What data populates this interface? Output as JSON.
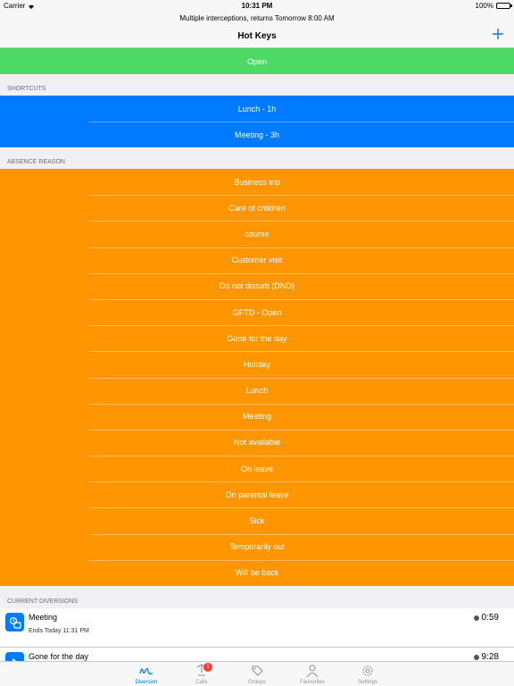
{
  "status_bar": {
    "carrier": "Carrier",
    "time": "10:31 PM",
    "battery": "100%"
  },
  "nav": {
    "subtitle": "Multiple interceptions, returns Tomorrow 8:00 AM",
    "title": "Hot Keys",
    "add_icon": "plus-icon"
  },
  "open_button": {
    "label": "Open",
    "color": "#4cd964"
  },
  "shortcuts": {
    "header": "SHORTCUTS",
    "color": "#007aff",
    "items": [
      "Lunch - 1h",
      "Meeting - 3h"
    ]
  },
  "absence": {
    "header": "ABSENCE REASON",
    "color": "#ff9500",
    "items": [
      "Business trip",
      "Care of children",
      "course",
      "Customer visit",
      "Do not disturb (DND)",
      "GFTD - Open",
      "Gone for the day",
      "Holiday",
      "Lunch",
      "Meeting",
      "Not available",
      "On leave",
      "On parental leave",
      "Sick",
      "Temporarily out",
      "Will be back"
    ]
  },
  "current_diversions": {
    "header": "CURRENT DIVERSIONS",
    "items": [
      {
        "name": "Meeting",
        "ends": "Ends Today 11:31 PM",
        "timer": "0:59"
      },
      {
        "name": "Gone for the day",
        "ends": "",
        "timer": "9:28"
      }
    ]
  },
  "tabbar": {
    "tabs": [
      {
        "label": "Diversion",
        "icon": "diversion-icon",
        "active": true
      },
      {
        "label": "Calls",
        "icon": "calls-icon",
        "badge": "1"
      },
      {
        "label": "Groups",
        "icon": "groups-icon"
      },
      {
        "label": "Favourites",
        "icon": "favourites-icon"
      },
      {
        "label": "Settings",
        "icon": "settings-icon"
      }
    ]
  }
}
